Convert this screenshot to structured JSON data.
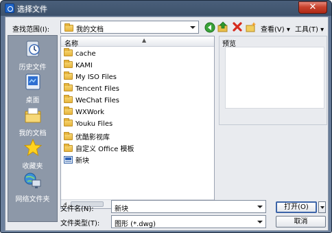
{
  "window": {
    "title": "选择文件",
    "close_label": "✕"
  },
  "toolbar": {
    "look_in_label": "查找范围(I):",
    "look_in_value": "我的文档",
    "view_label": "查看(V)",
    "tools_label": "工具(T)",
    "arrow": "▾"
  },
  "places": [
    {
      "label": "历史文件",
      "icon": "history-icon"
    },
    {
      "label": "桌面",
      "icon": "desktop-icon"
    },
    {
      "label": "我的文档",
      "icon": "my-documents-icon"
    },
    {
      "label": "收藏夹",
      "icon": "favorites-star-icon"
    },
    {
      "label": "网络文件夹",
      "icon": "network-folder-icon"
    }
  ],
  "file_list": {
    "column_header": "名称",
    "sort_indicator": "▲",
    "items": [
      {
        "name": "cache",
        "type": "folder"
      },
      {
        "name": "KAMI",
        "type": "folder"
      },
      {
        "name": "My ISO Files",
        "type": "folder"
      },
      {
        "name": "Tencent Files",
        "type": "folder"
      },
      {
        "name": "WeChat Files",
        "type": "folder"
      },
      {
        "name": "WXWork",
        "type": "folder"
      },
      {
        "name": "Youku Files",
        "type": "folder"
      },
      {
        "name": "优酷影视库",
        "type": "folder"
      },
      {
        "name": "自定义 Office 模板",
        "type": "folder"
      },
      {
        "name": "新块",
        "type": "dwg-file"
      }
    ]
  },
  "preview": {
    "label": "预览"
  },
  "filename": {
    "label": "文件名(N):",
    "value": "新块"
  },
  "filetype": {
    "label": "文件类型(T):",
    "value": "图形 (*.dwg)"
  },
  "buttons": {
    "open": "打开(O)",
    "cancel": "取消"
  },
  "colors": {
    "title_bar": "#3d516b",
    "places_bg": "#8d98a8",
    "client_bg": "#e9ebef",
    "close_red": "#c8432e"
  }
}
